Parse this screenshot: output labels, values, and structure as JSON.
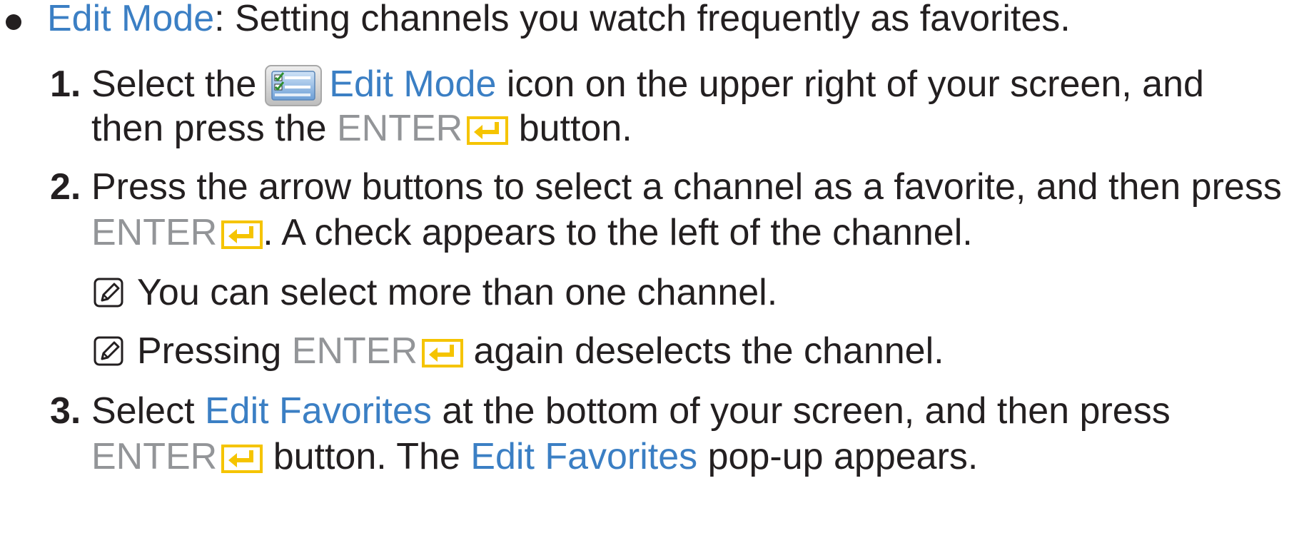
{
  "colors": {
    "text": "#231f20",
    "highlight": "#3b7fc4",
    "button": "#939598",
    "enter_icon": "#f5c400"
  },
  "icons": {
    "bullet": "bullet-dot-icon",
    "edit_mode": "edit-mode-icon",
    "enter": "enter-key-icon",
    "note": "note-pencil-icon"
  },
  "intro": {
    "term": "Edit Mode",
    "text": ": Setting channels you watch frequently as favorites."
  },
  "step1": {
    "number": "1.",
    "t1": "Select the",
    "term": "Edit Mode",
    "t2": " icon on the upper right of your screen, and",
    "t3": "then press the ",
    "key": "ENTER",
    "t4": " button."
  },
  "step2": {
    "number": "2.",
    "t1": "Press the arrow buttons to select a channel as a favorite, and then press",
    "key": "ENTER",
    "t2": ". A check appears to the left of the channel."
  },
  "note1": {
    "text": "You can select more than one channel."
  },
  "note2": {
    "t1": "Pressing ",
    "key": "ENTER",
    "t2": " again deselects the channel."
  },
  "step3": {
    "number": "3.",
    "t1": "Select ",
    "term": "Edit Favorites",
    "t2": " at the bottom of your screen, and then press",
    "key": "ENTER",
    "t3": " button. The ",
    "term2": "Edit Favorites",
    "t4": " pop-up appears."
  }
}
